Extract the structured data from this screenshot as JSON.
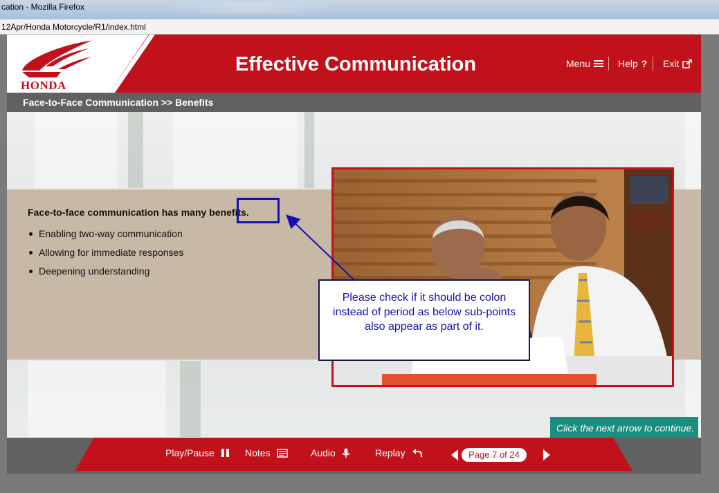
{
  "browser": {
    "window_title": "cation - Mozilla Firefox",
    "url": "12Apr/Honda Motorcycle/R1/index.html"
  },
  "header": {
    "logo_text": "HONDA",
    "title": "Effective Communication",
    "nav": [
      {
        "label": "Menu",
        "icon": "hamburger-icon"
      },
      {
        "label": "Help",
        "icon": "question-icon"
      },
      {
        "label": "Exit",
        "icon": "external-link-icon"
      }
    ]
  },
  "breadcrumb": "Face-to-Face Communication >> Benefits",
  "content": {
    "heading": "Face-to-face communication has many benefits.",
    "bullets": [
      "Enabling two-way communication",
      "Allowing for immediate responses",
      "Deepening understanding"
    ]
  },
  "annotation": {
    "note": "Please check if it should be colon instead of period as below sub-points also appear as part of it.",
    "color": "#1010b4"
  },
  "hint": "Click the next arrow to continue.",
  "footer": {
    "play_pause": "Play/Pause",
    "notes": "Notes",
    "audio": "Audio",
    "replay": "Replay",
    "page_indicator": "Page 7 of 24"
  },
  "colors": {
    "brand_red": "#c1111b",
    "gray_bar": "#616161",
    "content_band": "#c8b8a6",
    "hint_teal": "#1a8f7f"
  }
}
